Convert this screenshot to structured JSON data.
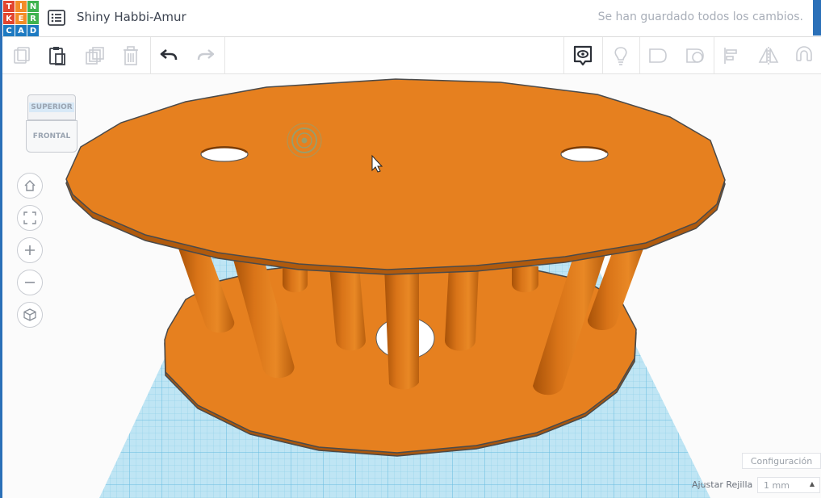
{
  "header": {
    "logo_letters": [
      "T",
      "I",
      "N",
      "K",
      "E",
      "R",
      "C",
      "A",
      "D"
    ],
    "logo_colors": [
      "#e2452f",
      "#f28c28",
      "#3fb34f",
      "#e2452f",
      "#f28c28",
      "#3fb34f",
      "#1d7ac2",
      "#1d7ac2",
      "#1d7ac2"
    ],
    "title": "Shiny Habbi-Amur",
    "save_status": "Se han guardado todos los cambios."
  },
  "toolbar": {
    "left_icons": [
      "copy-icon",
      "paste-icon",
      "duplicate-icon",
      "delete-icon",
      "undo-icon",
      "redo-icon"
    ],
    "right_icons": [
      "notes-icon",
      "light-icon",
      "shape-outline-icon",
      "hole-icon",
      "align-icon",
      "mirror-icon",
      "magnet-icon"
    ]
  },
  "view_cube": {
    "top_label": "SUPERIOR",
    "front_label": "FRONTAL"
  },
  "nav_controls": [
    "home-icon",
    "fit-view-icon",
    "zoom-in-icon",
    "zoom-out-icon",
    "perspective-icon"
  ],
  "bottom_right": {
    "config_label": "Configuración",
    "snap_label": "Ajustar Rejilla",
    "snap_value": "1 mm"
  },
  "colors": {
    "shape": "#e6801f",
    "shape_dark": "#b85c0e",
    "grid": "#a6d9ee",
    "accent": "#2b70b8"
  }
}
